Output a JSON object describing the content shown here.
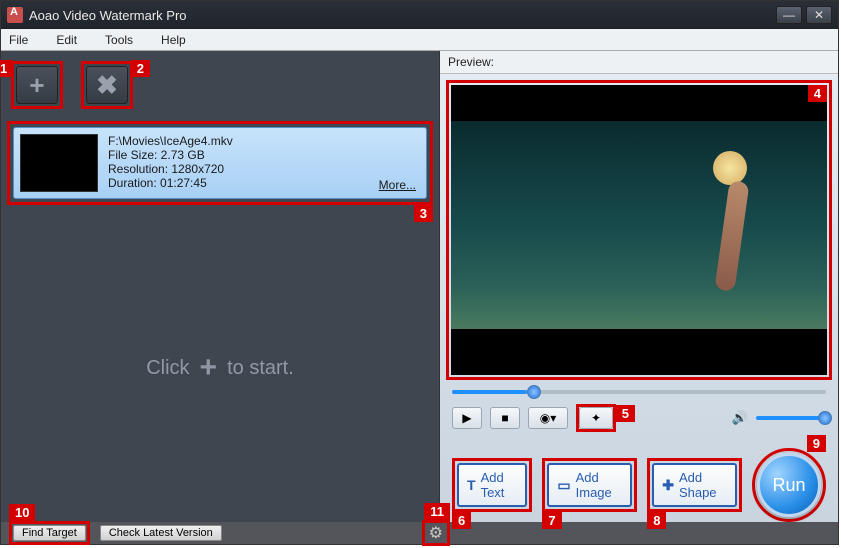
{
  "window": {
    "title": "Aoao Video Watermark Pro"
  },
  "menu": {
    "file": "File",
    "edit": "Edit",
    "tools": "Tools",
    "help": "Help"
  },
  "toolbar": {
    "add_tooltip": "Add",
    "remove_tooltip": "Remove"
  },
  "file": {
    "path": "F:\\Movies\\IceAge4.mkv",
    "size_label": "File Size: 2.73 GB",
    "resolution_label": "Resolution: 1280x720",
    "duration_label": "Duration: 01:27:45",
    "more": "More..."
  },
  "hint": {
    "pre": "Click",
    "post": "to start."
  },
  "preview": {
    "label": "Preview:"
  },
  "actions": {
    "add_text": "Add Text",
    "add_image": "Add Image",
    "add_shape": "Add Shape",
    "run": "Run"
  },
  "status": {
    "find_target": "Find Target",
    "check_version": "Check Latest Version"
  },
  "annotations": {
    "n1": "1",
    "n2": "2",
    "n3": "3",
    "n4": "4",
    "n5": "5",
    "n6": "6",
    "n7": "7",
    "n8": "8",
    "n9": "9",
    "n10": "10",
    "n11": "11"
  }
}
